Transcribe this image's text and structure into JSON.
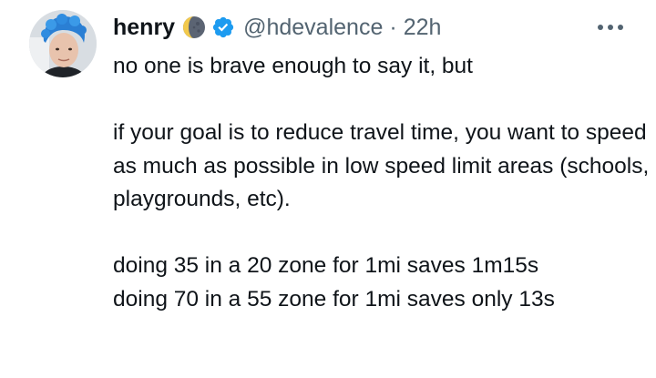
{
  "tweet": {
    "display_name": "henry",
    "handle": "@hdevalence",
    "separator": "·",
    "time": "22h",
    "emoji_icon": "moon-phase-icon",
    "verified_icon": "verified-badge-icon",
    "more_icon": "more-options-icon",
    "text": {
      "line1": "no one is brave enough to say it, but",
      "para2": "if your goal is to reduce travel time, you want to speed as much as possible in low speed limit areas (schools, playgrounds, etc).",
      "para3_line1": "doing 35 in a 20 zone for 1mi saves 1m15s",
      "para3_line2": "doing 70 in a 55 zone for 1mi saves only 13s"
    }
  },
  "colors": {
    "text_primary": "#0f1419",
    "text_secondary": "#536471",
    "verified_blue": "#1d9bf0"
  }
}
